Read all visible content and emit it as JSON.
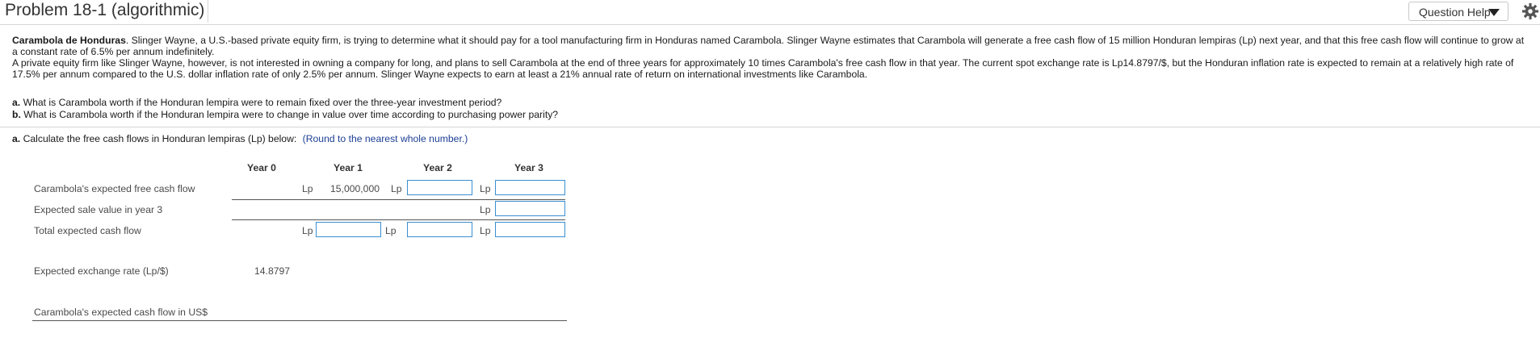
{
  "header": {
    "title": "Problem 18-1 (algorithmic)",
    "help_label": "Question Help"
  },
  "problem": {
    "lead_bold": "Carambola de Honduras",
    "para1": ". Slinger Wayne, a U.S.-based private equity firm, is trying to determine what it should pay for a tool manufacturing firm in Honduras named Carambola. Slinger Wayne estimates that Carambola will generate a free cash flow of 15 million Honduran lempiras (Lp) next year, and that this free cash flow will continue to grow at a constant rate of 6.5% per annum indefinitely.",
    "para2": "A private equity firm like Slinger Wayne, however, is not interested in owning a company for long, and plans to sell Carambola at the end of three years for approximately 10 times Carambola's free cash flow in that year. The current spot exchange rate is Lp14.8797/$, but the Honduran inflation rate is expected to remain at a relatively high rate of 17.5% per annum compared to the U.S. dollar inflation rate of only 2.5% per annum. Slinger Wayne expects to earn at least a 21% annual rate of return on international investments like Carambola."
  },
  "questions": {
    "a_label": "a.",
    "a_text": "What is Carambola worth if the Honduran lempira were to remain fixed over the three-year investment period?",
    "b_label": "b.",
    "b_text": "What is Carambola worth if the Honduran lempira were to change in value over time according to purchasing power parity?"
  },
  "instruction": {
    "label": "a.",
    "text": "Calculate the free cash flows in Honduran lempiras (Lp) below:",
    "hint": "(Round to the nearest whole number.)"
  },
  "table": {
    "columns": [
      "Year 0",
      "Year 1",
      "Year 2",
      "Year 3"
    ],
    "currency": "Lp",
    "rows": {
      "fcf_label": "Carambola's expected free cash flow",
      "fcf_year1": "15,000,000",
      "sale_label": "Expected sale value in year 3",
      "total_label": "Total expected cash flow",
      "fx_label": "Expected exchange rate (Lp/$)",
      "fx_year0": "14.8797",
      "usd_label": "Carambola's expected cash flow in US$"
    },
    "inputs": {
      "fcf_year2": "",
      "fcf_year3": "",
      "sale_year3": "",
      "total_year0": "",
      "total_year2": "",
      "total_year3": ""
    }
  },
  "colors": {
    "input_border": "#3a8fd0",
    "hint": "#1c3f95"
  }
}
